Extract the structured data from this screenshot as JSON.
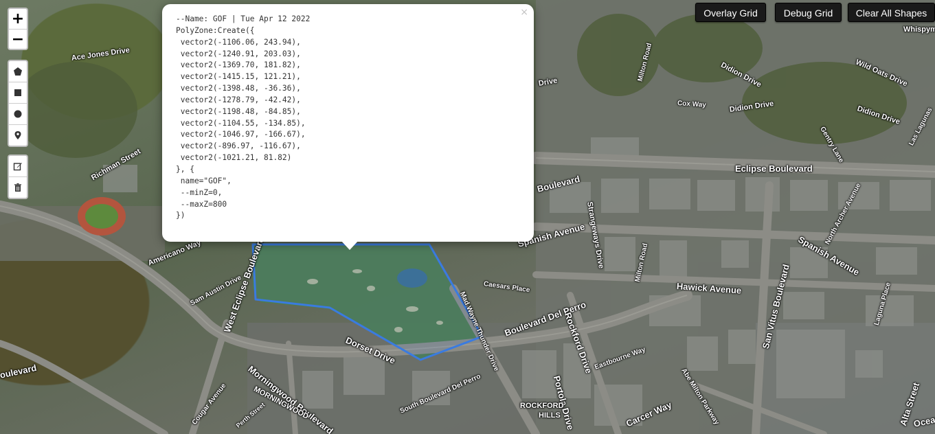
{
  "map": {
    "road_labels": [
      {
        "text": "Ace Jones Drive",
        "size": 11
      },
      {
        "text": "Richman Street",
        "size": 11
      },
      {
        "text": "Americano Way",
        "size": 11
      },
      {
        "text": "Sam Austin Drive",
        "size": 10
      },
      {
        "text": "West Eclipse Boulevard",
        "size": 13
      },
      {
        "text": "Dorset Drive",
        "size": 13
      },
      {
        "text": "Morningwood Boulevard",
        "size": 13
      },
      {
        "text": "MORNINGWOOD",
        "size": 11
      },
      {
        "text": "Cougar Avenue",
        "size": 10
      },
      {
        "text": "Perth Street",
        "size": 9
      },
      {
        "text": "South Boulevard Del Perro",
        "size": 10
      },
      {
        "text": "Boulevard Del Perro",
        "size": 13
      },
      {
        "text": "Mad Wayne Thunder Drive",
        "size": 10
      },
      {
        "text": "Caesars Place",
        "size": 10
      },
      {
        "text": "Spanish Avenue",
        "size": 13
      },
      {
        "text": "Strangeways Drive",
        "size": 11
      },
      {
        "text": "Milton Road",
        "size": 10
      },
      {
        "text": "Eclipse Boulevard",
        "size": 13
      },
      {
        "text": "Hawick Avenue",
        "size": 13
      },
      {
        "text": "Rockford Drive",
        "size": 13
      },
      {
        "text": "Portola Drive",
        "size": 13
      },
      {
        "text": "ROCKFORD",
        "size": 11
      },
      {
        "text": "HILLS",
        "size": 11
      },
      {
        "text": "Carcer Way",
        "size": 13
      },
      {
        "text": "Eastbourne Way",
        "size": 10
      },
      {
        "text": "Abe Milton Parkway",
        "size": 10
      },
      {
        "text": "San Vitus Boulevard",
        "size": 13
      },
      {
        "text": "Spanish Avenue",
        "size": 13
      },
      {
        "text": "North Archer Avenue",
        "size": 10
      },
      {
        "text": "Laguna Place",
        "size": 10
      },
      {
        "text": "Alta Street",
        "size": 13
      },
      {
        "text": "Cox Way",
        "size": 10
      },
      {
        "text": "Didion Drive",
        "size": 11
      },
      {
        "text": "Didion Drive",
        "size": 11
      },
      {
        "text": "Wild Oats Drive",
        "size": 11
      },
      {
        "text": "Whispymound",
        "size": 11
      },
      {
        "text": "Milton Road",
        "size": 10
      },
      {
        "text": "Drive",
        "size": 11
      },
      {
        "text": "Didion Drive",
        "size": 11
      },
      {
        "text": "Gentry Lane",
        "size": 10
      },
      {
        "text": "Las Lagunas",
        "size": 10
      },
      {
        "text": "Boulevard",
        "size": 13
      },
      {
        "text": "oulevard",
        "size": 13
      },
      {
        "text": "Ocean",
        "size": 13
      }
    ]
  },
  "controls": {
    "zoom_in": "+",
    "zoom_out": "−",
    "draw_tools": [
      {
        "name": "draw-polygon-button",
        "icon": "pentagon-icon"
      },
      {
        "name": "draw-rectangle-button",
        "icon": "square-icon"
      },
      {
        "name": "draw-circle-button",
        "icon": "circle-icon"
      },
      {
        "name": "draw-marker-button",
        "icon": "marker-icon"
      }
    ],
    "edit_tools": [
      {
        "name": "edit-layers-button",
        "icon": "edit-icon"
      },
      {
        "name": "delete-layers-button",
        "icon": "trash-icon"
      }
    ]
  },
  "toolbar": {
    "overlay_grid": "Overlay Grid",
    "debug_grid": "Debug Grid",
    "clear_shapes": "Clear All Shapes"
  },
  "popup": {
    "close": "×",
    "lines": [
      "--Name: GOF | Tue Apr 12 2022",
      "PolyZone:Create({",
      " vector2(-1106.06, 243.94),",
      " vector2(-1240.91, 203.03),",
      " vector2(-1369.70, 181.82),",
      " vector2(-1415.15, 121.21),",
      " vector2(-1398.48, -36.36),",
      " vector2(-1278.79, -42.42),",
      " vector2(-1198.48, -84.85),",
      " vector2(-1104.55, -134.85),",
      " vector2(-1046.97, -166.67),",
      " vector2(-896.97, -116.67),",
      " vector2(-1021.21, 81.82)",
      "}, {",
      " name=\"GOF\",",
      " --minZ=0,",
      " --maxZ=800",
      "})"
    ]
  },
  "colors": {
    "polygon_stroke": "#3a7be0",
    "golf_green": "#4f7d4b"
  }
}
